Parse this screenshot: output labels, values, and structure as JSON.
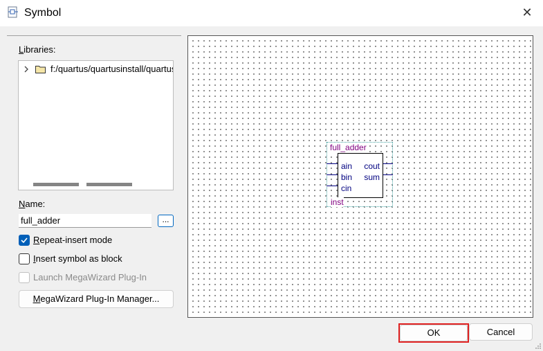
{
  "window": {
    "title": "Symbol",
    "icon": "symbol-file-icon",
    "close_label": "✕"
  },
  "libraries": {
    "label": "Libraries:",
    "tree_items": [
      {
        "label": "f:/quartus/quartusinstall/quartus",
        "icon": "folder-icon",
        "expander": "chevron-right-icon"
      }
    ]
  },
  "name": {
    "label": "Name:",
    "value": "full_adder",
    "browse_label": "..."
  },
  "options": {
    "repeat_insert": {
      "label": "Repeat-insert mode",
      "checked": true
    },
    "insert_block": {
      "label": "Insert symbol as block",
      "checked": false
    },
    "launch_megawizard": {
      "label": "Launch MegaWizard Plug-In",
      "checked": false,
      "disabled": true
    }
  },
  "megawizard_button": "MegaWizard Plug-In Manager...",
  "preview": {
    "symbol_name": "full_adder",
    "inputs": [
      "ain",
      "bin",
      "cin"
    ],
    "outputs": [
      "cout",
      "sum"
    ],
    "instance": "inst"
  },
  "buttons": {
    "ok": "OK",
    "cancel": "Cancel"
  },
  "colors": {
    "accent": "#005fb8",
    "highlight": "#e02020",
    "symbol_text": "#800080",
    "port_text": "#000080"
  }
}
